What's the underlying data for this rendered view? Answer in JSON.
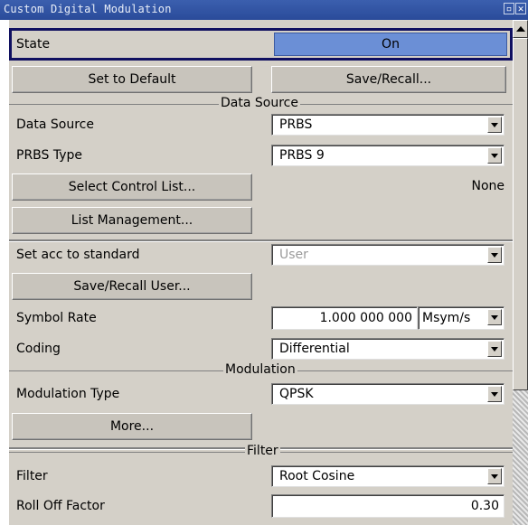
{
  "window": {
    "title": "Custom Digital Modulation"
  },
  "state": {
    "label": "State",
    "value": "On"
  },
  "buttons": {
    "set_default": "Set to Default",
    "save_recall": "Save/Recall..."
  },
  "data_source_section": {
    "title": "Data Source",
    "data_source_label": "Data Source",
    "data_source_value": "PRBS",
    "prbs_type_label": "PRBS Type",
    "prbs_type_value": "PRBS 9",
    "select_control_list": "Select Control List...",
    "control_list_value": "None",
    "list_management": "List Management..."
  },
  "standard": {
    "label": "Set acc to standard",
    "value": "User",
    "save_recall_user": "Save/Recall User..."
  },
  "symbol_rate": {
    "label": "Symbol Rate",
    "value": "1.000 000 000",
    "unit": "Msym/s"
  },
  "coding": {
    "label": "Coding",
    "value": "Differential"
  },
  "modulation_section": {
    "title": "Modulation",
    "type_label": "Modulation Type",
    "type_value": "QPSK",
    "more": "More..."
  },
  "filter_section": {
    "title": "Filter",
    "filter_label": "Filter",
    "filter_value": "Root Cosine",
    "rolloff_label": "Roll Off Factor",
    "rolloff_value": "0.30"
  },
  "colors": {
    "state_on": "#6b8fd6",
    "focus_border": "#101060",
    "panel": "#d4d0c8",
    "titlebar": "#2f53a2"
  }
}
